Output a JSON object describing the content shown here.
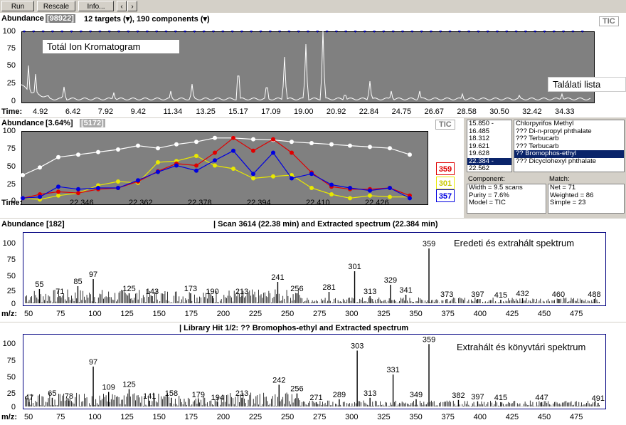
{
  "toolbar": {
    "run": "Run",
    "rescale": "Rescale",
    "info": "Info...",
    "prev": "‹",
    "next": "›"
  },
  "tic_panel": {
    "abundance_label": "Abundance",
    "abundance_value": "[98922]",
    "targets": "12 targets (▾), 190 components (▾)",
    "badge": "TIC",
    "note": "Totál Ion Kromatogram",
    "y_ticks": [
      "100",
      "75",
      "50",
      "25",
      "0"
    ],
    "time_label": "Time:",
    "x_ticks": [
      "4.92",
      "6.42",
      "7.92",
      "9.42",
      "11.34",
      "13.25",
      "15.17",
      "17.09",
      "19.00",
      "20.92",
      "22.84",
      "24.75",
      "26.67",
      "28.58",
      "30.50",
      "32.42",
      "34.33"
    ]
  },
  "ion_panel": {
    "abundance_label": "Abundance",
    "abundance_value": "[3.64%]",
    "abundance_value2": "[5172]",
    "badge": "TIC",
    "y_ticks": [
      "100",
      "75",
      "50",
      "25",
      "0"
    ],
    "time_label": "Time:",
    "x_ticks": [
      "22.346",
      "22.362",
      "22.378",
      "22.394",
      "22.410",
      "22.426"
    ],
    "ions": [
      {
        "label": "359",
        "color": "#e00000"
      },
      {
        "label": "301",
        "color": "#e8e800"
      },
      {
        "label": "357",
        "color": "#0000e0"
      }
    ]
  },
  "hit_list": {
    "note": "Találati lista",
    "times": [
      "15.850 -",
      "16.485",
      "18.312",
      "19.621",
      "19.628",
      "22.384 -",
      "22.562"
    ],
    "names": [
      "Chlorpyrifos Methyl",
      "??? Di-n-propyl phthalate",
      "??? Terbucarb",
      "??? Terbucarb",
      "?? Bromophos-ethyl",
      "??? Dicyclohexyl phthalate"
    ],
    "component_label": "Component:",
    "component": [
      "Width = 9.5 scans",
      "Purity = 7.6%",
      "Model = TIC"
    ],
    "match_label": "Match:",
    "match": [
      "Net = 71",
      "Weighted = 86",
      "Simple = 23"
    ]
  },
  "spectrum_panel": {
    "abundance_label": "Abundance [182]",
    "title": "| Scan 3614 (22.38 min) and  Extracted spectrum (22.384 min)",
    "note": "Eredeti és extrahált spektrum",
    "y_ticks": [
      "100",
      "75",
      "50",
      "25",
      "0"
    ],
    "mz_label": "m/z:",
    "x_ticks": [
      "50",
      "75",
      "100",
      "125",
      "150",
      "175",
      "200",
      "225",
      "250",
      "275",
      "300",
      "325",
      "350",
      "375",
      "400",
      "425",
      "450",
      "475"
    ],
    "peaks": [
      [
        "55",
        "55"
      ],
      [
        "71",
        "71"
      ],
      [
        "85",
        "85"
      ],
      [
        "97",
        "97"
      ],
      [
        "125",
        "125"
      ],
      [
        "143",
        "143"
      ],
      [
        "173",
        "173"
      ],
      [
        "190",
        "190"
      ],
      [
        "213",
        "213"
      ],
      [
        "241",
        "241"
      ],
      [
        "256",
        "256"
      ],
      [
        "281",
        "281"
      ],
      [
        "301",
        "301"
      ],
      [
        "313",
        "313"
      ],
      [
        "329",
        "329"
      ],
      [
        "341",
        "341"
      ],
      [
        "359",
        "359"
      ],
      [
        "373",
        "373"
      ],
      [
        "397",
        "397"
      ],
      [
        "415",
        "415"
      ],
      [
        "432",
        "432"
      ],
      [
        "460",
        "460"
      ],
      [
        "488",
        "488"
      ]
    ]
  },
  "library_panel": {
    "title": "| Library Hit 1/2: ?? Bromophos-ethyl and  Extracted spectrum",
    "note": "Extrahált és könyvtári spektrum",
    "y_ticks": [
      "100",
      "75",
      "50",
      "25",
      "0"
    ],
    "mz_label": "m/z:",
    "x_ticks": [
      "50",
      "75",
      "100",
      "125",
      "150",
      "175",
      "200",
      "225",
      "250",
      "275",
      "300",
      "325",
      "350",
      "375",
      "400",
      "425",
      "450",
      "475"
    ],
    "peaks": [
      [
        "47",
        "47"
      ],
      [
        "65",
        "65"
      ],
      [
        "78",
        "78"
      ],
      [
        "97",
        "97"
      ],
      [
        "109",
        "109"
      ],
      [
        "125",
        "125"
      ],
      [
        "141",
        "141"
      ],
      [
        "158",
        "158"
      ],
      [
        "179",
        "179"
      ],
      [
        "194",
        "194"
      ],
      [
        "213",
        "213"
      ],
      [
        "242",
        "242"
      ],
      [
        "256",
        "256"
      ],
      [
        "271",
        "271"
      ],
      [
        "289",
        "289"
      ],
      [
        "303",
        "303"
      ],
      [
        "313",
        "313"
      ],
      [
        "331",
        "331"
      ],
      [
        "349",
        "349"
      ],
      [
        "359",
        "359"
      ],
      [
        "382",
        "382"
      ],
      [
        "397",
        "397"
      ],
      [
        "415",
        "415"
      ],
      [
        "447",
        "447"
      ],
      [
        "491",
        "491"
      ]
    ]
  },
  "colors": {
    "plot_bg": "#808080",
    "frame": "#000080",
    "select": "#0a246a"
  }
}
